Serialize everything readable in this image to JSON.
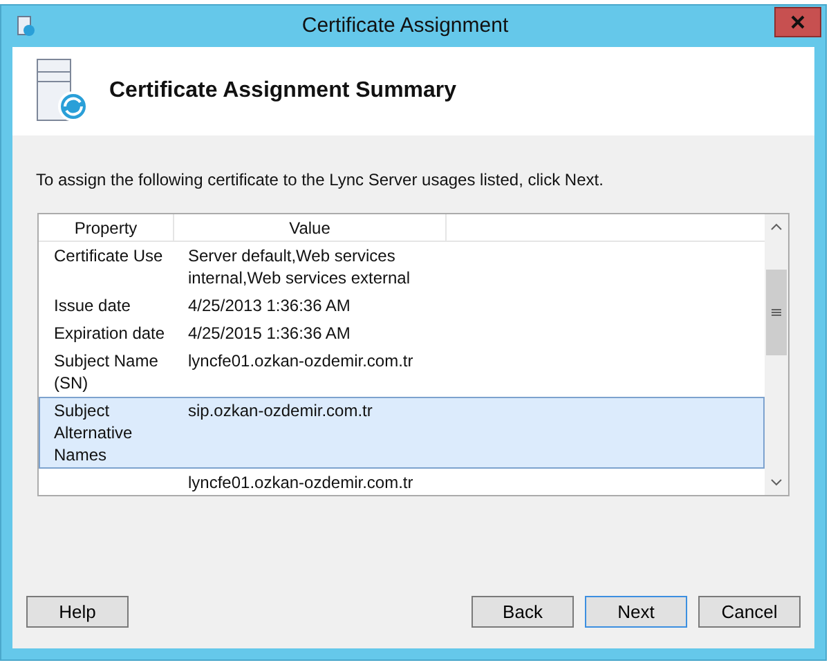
{
  "window": {
    "title": "Certificate Assignment"
  },
  "header": {
    "title": "Certificate Assignment Summary"
  },
  "instruction": "To assign the following certificate to the Lync Server usages listed, click Next.",
  "table": {
    "columns": [
      "Property",
      "Value"
    ],
    "rows": [
      {
        "property": "Certificate Use",
        "value": "Server default,Web services internal,Web services external",
        "selected": false
      },
      {
        "property": "Issue date",
        "value": "4/25/2013 1:36:36 AM",
        "selected": false
      },
      {
        "property": "Expiration date",
        "value": "4/25/2015 1:36:36 AM",
        "selected": false
      },
      {
        "property": "Subject Name (SN)",
        "value": "lyncfe01.ozkan-ozdemir.com.tr",
        "selected": false
      },
      {
        "property": "Subject Alternative Names",
        "value": "sip.ozkan-ozdemir.com.tr",
        "selected": true
      },
      {
        "property": "",
        "value": "lyncfe01.ozkan-ozdemir.com.tr",
        "selected": false
      }
    ]
  },
  "buttons": [
    {
      "label": "Help",
      "default": false
    },
    {
      "label": "Back",
      "default": false
    },
    {
      "label": "Next",
      "default": true
    },
    {
      "label": "Cancel",
      "default": false
    }
  ]
}
